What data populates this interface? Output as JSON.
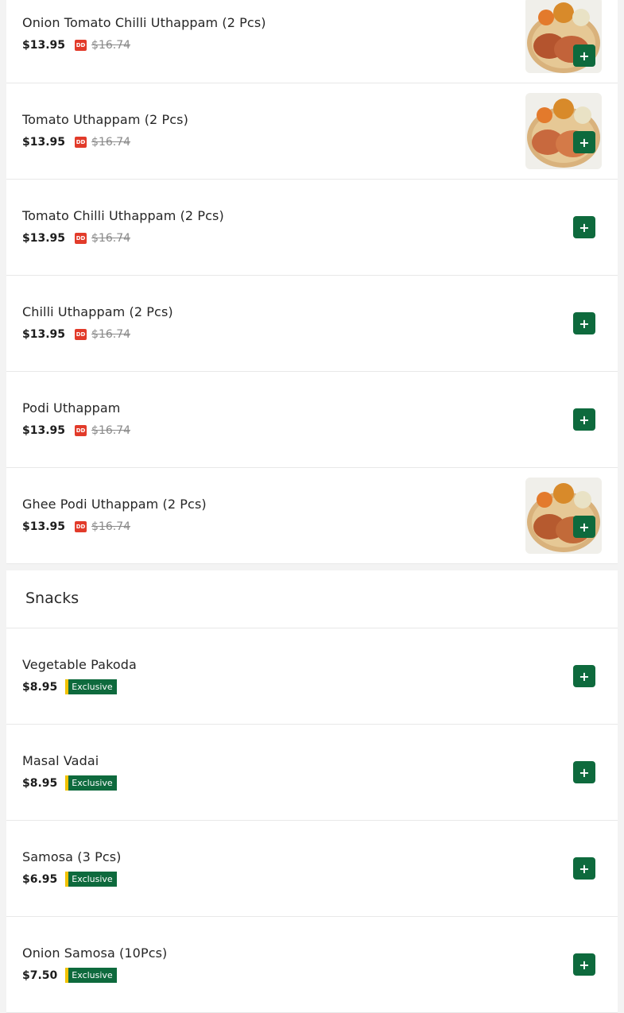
{
  "uthappam": [
    {
      "name": "Onion Tomato Chilli Uthappam (2 Pcs)",
      "price": "$13.95",
      "old_price": "$16.74",
      "badge": "DD",
      "has_image": true
    },
    {
      "name": "Tomato Uthappam (2 Pcs)",
      "price": "$13.95",
      "old_price": "$16.74",
      "badge": "DD",
      "has_image": true
    },
    {
      "name": "Tomato Chilli Uthappam (2 Pcs)",
      "price": "$13.95",
      "old_price": "$16.74",
      "badge": "DD",
      "has_image": false
    },
    {
      "name": "Chilli Uthappam (2 Pcs)",
      "price": "$13.95",
      "old_price": "$16.74",
      "badge": "DD",
      "has_image": false
    },
    {
      "name": "Podi Uthappam",
      "price": "$13.95",
      "old_price": "$16.74",
      "badge": "DD",
      "has_image": false
    },
    {
      "name": "Ghee Podi Uthappam (2 Pcs)",
      "price": "$13.95",
      "old_price": "$16.74",
      "badge": "DD",
      "has_image": true
    }
  ],
  "snacks": {
    "title": "Snacks",
    "items": [
      {
        "name": "Vegetable Pakoda",
        "price": "$8.95",
        "tag": "Exclusive"
      },
      {
        "name": "Masal Vadai",
        "price": "$8.95",
        "tag": "Exclusive"
      },
      {
        "name": "Samosa (3 Pcs)",
        "price": "$6.95",
        "tag": "Exclusive"
      },
      {
        "name": "Onion Samosa (10Pcs)",
        "price": "$7.50",
        "tag": "Exclusive"
      }
    ]
  },
  "colors": {
    "brand_green": "#0e6a3d",
    "dd_red": "#e23b2a",
    "exclusive_yellow": "#f2c200"
  },
  "icons": {
    "add": "plus-icon"
  }
}
